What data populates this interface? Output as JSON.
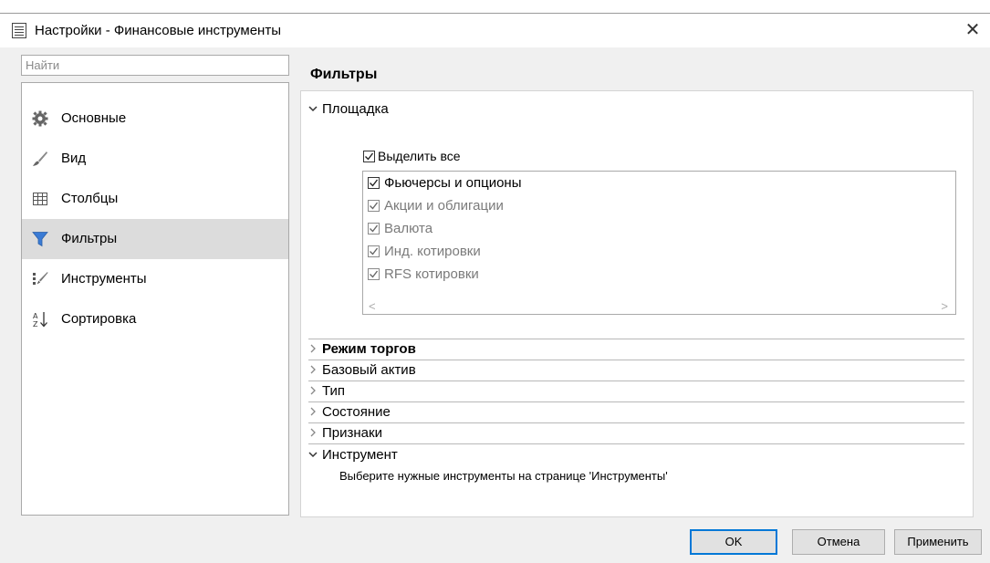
{
  "window": {
    "title": "Настройки - Финансовые инструменты"
  },
  "search": {
    "placeholder": "Найти",
    "value": ""
  },
  "nav": {
    "items": [
      {
        "label": "Основные",
        "icon": "gear-icon"
      },
      {
        "label": "Вид",
        "icon": "brush-icon"
      },
      {
        "label": "Столбцы",
        "icon": "columns-icon"
      },
      {
        "label": "Фильтры",
        "icon": "filter-icon",
        "selected": true
      },
      {
        "label": "Инструменты",
        "icon": "tools-icon"
      },
      {
        "label": "Сортировка",
        "icon": "sort-az-icon"
      }
    ]
  },
  "filters": {
    "title": "Фильтры",
    "venue": {
      "label": "Площадка",
      "expanded": true,
      "select_all": {
        "label": "Выделить все",
        "checked": true
      },
      "items": [
        {
          "label": "Фьючерсы и опционы",
          "checked": true,
          "enabled": true
        },
        {
          "label": "Акции и облигации",
          "checked": true,
          "enabled": false
        },
        {
          "label": "Валюта",
          "checked": true,
          "enabled": false
        },
        {
          "label": "Инд. котировки",
          "checked": true,
          "enabled": false
        },
        {
          "label": "RFS котировки",
          "checked": true,
          "enabled": false
        }
      ]
    },
    "groups": [
      {
        "label": "Режим торгов",
        "bold": true,
        "expanded": false
      },
      {
        "label": "Базовый актив",
        "expanded": false
      },
      {
        "label": "Тип",
        "expanded": false
      },
      {
        "label": "Состояние",
        "expanded": false
      },
      {
        "label": "Признаки",
        "expanded": false
      },
      {
        "label": "Инструмент",
        "expanded": true
      }
    ],
    "instrument_hint": "Выберите нужные инструменты на странице 'Инструменты'"
  },
  "buttons": {
    "ok": "OK",
    "cancel": "Отмена",
    "apply": "Применить"
  },
  "colors": {
    "selection_bg": "#dcdcdc",
    "default_button_border": "#0078d7",
    "filter_icon": "#3a7bd5"
  }
}
